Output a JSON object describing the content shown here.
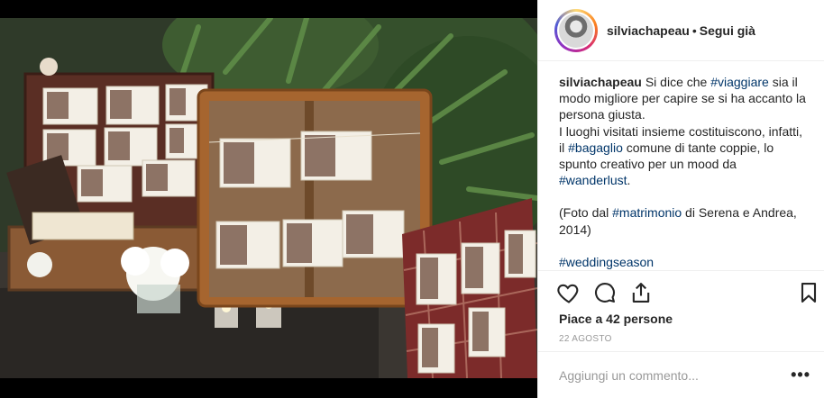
{
  "post": {
    "username": "silviachapeau",
    "separator": "•",
    "follow_label": "Segui già",
    "caption": {
      "username": "silviachapeau",
      "line1_a": "Si dice che ",
      "tag_viaggiare": "#viaggiare",
      "line1_b": " sia il modo migliore per capire se si ha accanto la persona giusta.",
      "line2_a": "I luoghi visitati insieme costituiscono, infatti, il ",
      "tag_bagaglio": "#bagaglio",
      "line2_b": " comune di tante coppie, lo spunto creativo per un mood da ",
      "tag_wanderlust": "#wanderlust",
      "line2_c": ".",
      "line3_a": "(Foto dal ",
      "tag_matrimonio": "#matrimonio",
      "line3_b": " di Serena e Andrea, 2014)",
      "tag_weddingseason": "#weddingseason"
    },
    "likes_text": "Piace a 42 persone",
    "date": "22 agosto",
    "comment_placeholder": "Aggiungi un commento...",
    "more_label": "•••"
  },
  "icons": {
    "like": "heart-icon",
    "comment": "comment-icon",
    "share": "share-icon",
    "save": "bookmark-icon"
  },
  "colors": {
    "hashtag": "#003569",
    "text": "#262626",
    "muted": "#999999",
    "border": "#efefef"
  }
}
